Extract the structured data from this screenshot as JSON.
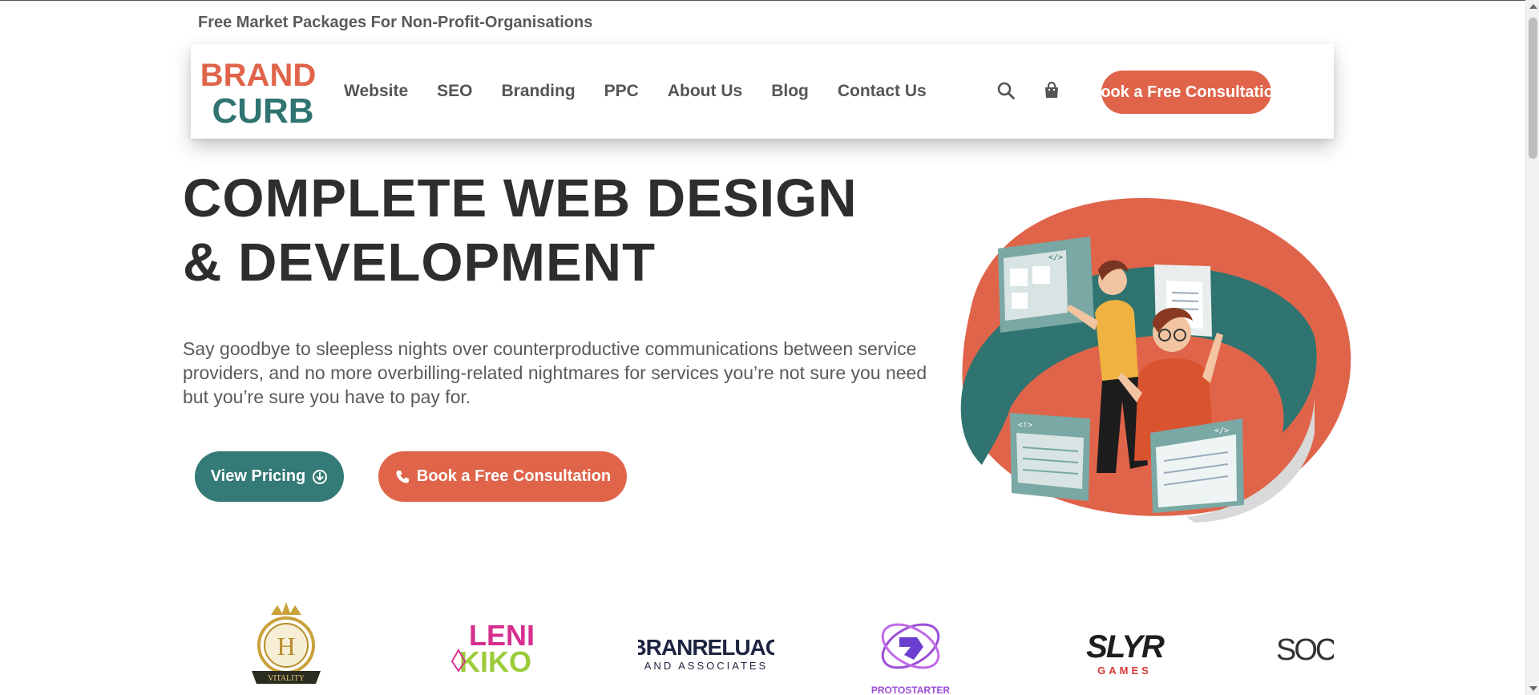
{
  "announcement": "Free Market Packages For Non-Profit-Organisations",
  "logo": {
    "line1": "BRAND",
    "line2": "CURB"
  },
  "nav": {
    "items": [
      "Website",
      "SEO",
      "Branding",
      "PPC",
      "About Us",
      "Blog",
      "Contact Us"
    ],
    "search_icon": "search-icon",
    "cart_icon": "shopping-bag-icon",
    "cta_label": "Book a Free Consultation"
  },
  "hero": {
    "title_line1": "COMPLETE WEB DESIGN",
    "title_line2": "& DEVELOPMENT",
    "description": "Say goodbye to sleepless nights over counterproductive communications between service providers, and no more overbilling-related nightmares for services you’re not sure you need but you’re sure you have to pay for.",
    "btn_pricing": "View Pricing",
    "btn_consult": "Book a Free Consultation"
  },
  "clients": {
    "vitality": {
      "letter": "H",
      "word": "VITALITY"
    },
    "leni": {
      "line1": "LENI",
      "line2": "KIKO"
    },
    "branreluao": {
      "line1": "BRANRELUAO",
      "line2": "AND ASSOCIATES"
    },
    "protostarter": {
      "word": "PROTOSTARTER"
    },
    "slyr": {
      "line1": "SLYR",
      "line2": "GAMES"
    },
    "soc": {
      "word": "SOC"
    }
  },
  "colors": {
    "accent": "#e0644a",
    "teal": "#347a76",
    "text_dark": "#2e2e2e",
    "text_muted": "#5a5a5a"
  }
}
